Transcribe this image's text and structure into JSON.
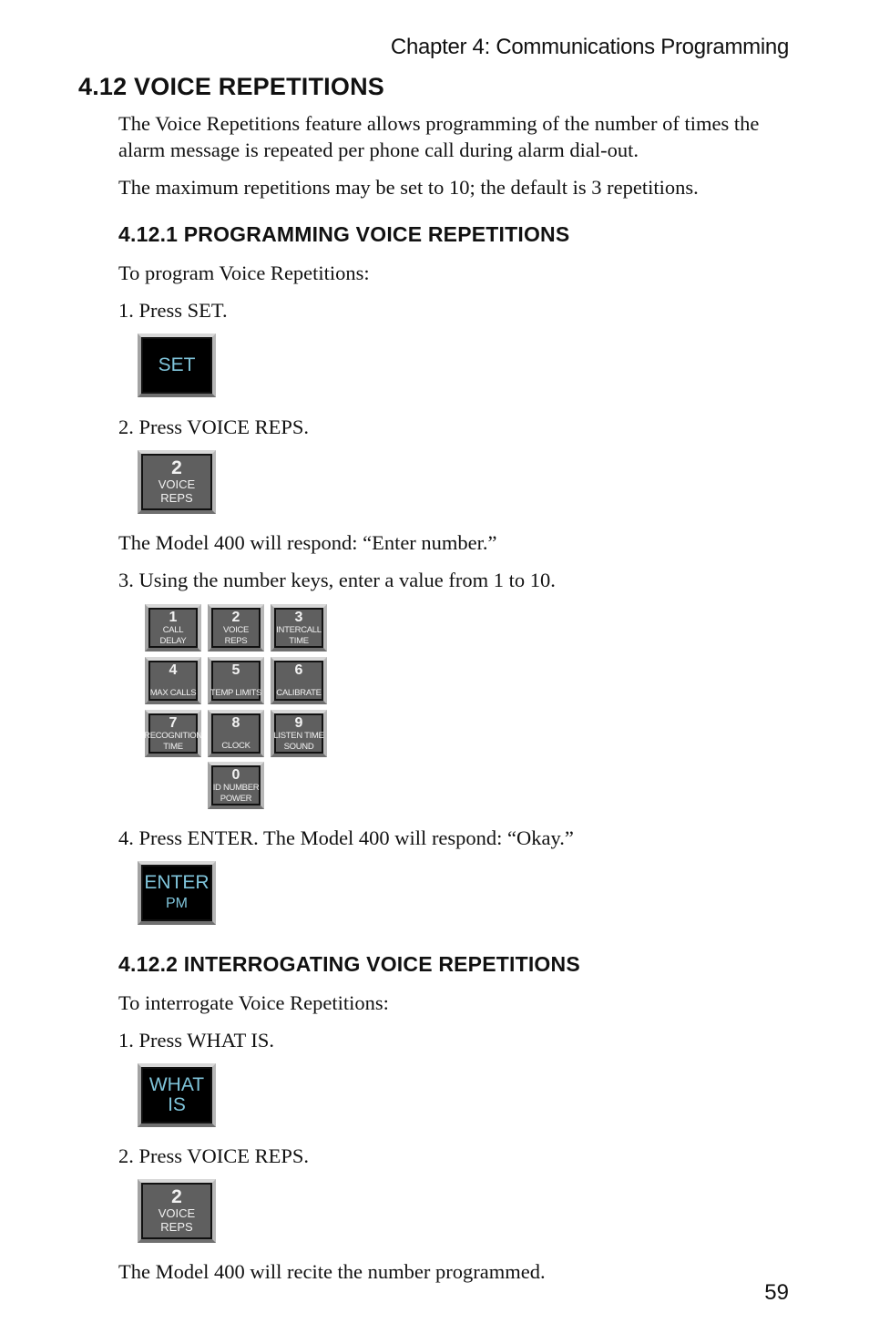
{
  "header": {
    "chapter": "Chapter 4: Communications Programming"
  },
  "section": {
    "title": "4.12 VOICE REPETITIONS",
    "paragraphs": [
      "The Voice Repetitions feature allows programming of the number of times the alarm message is repeated per phone call during alarm dial-out.",
      "The maximum repetitions may be set to 10; the default is 3 repetitions."
    ]
  },
  "programming": {
    "title": "4.12.1 PROGRAMMING VOICE REPETITIONS",
    "intro": "To program Voice Repetitions:",
    "step1": "1. Press SET.",
    "step2": "2. Press VOICE REPS.",
    "response1": "The Model 400 will respond: “Enter number.”",
    "step3": "3. Using the number keys, enter a value from 1 to 10.",
    "step4": "4. Press ENTER. The Model 400 will respond: “Okay.”"
  },
  "interrogating": {
    "title": "4.12.2 INTERROGATING VOICE REPETITIONS",
    "intro": "To interrogate Voice Repetitions:",
    "step1": "1. Press WHAT IS.",
    "step2": "2. Press VOICE REPS.",
    "result": "The Model 400 will recite the number programmed."
  },
  "keys": {
    "set": {
      "label": "SET"
    },
    "voice_reps": {
      "number": "2",
      "line1": "VOICE",
      "line2": "REPS"
    },
    "enter": {
      "line1": "ENTER",
      "line2": "PM"
    },
    "what_is": {
      "line1": "WHAT",
      "line2": "IS"
    }
  },
  "keypad": [
    {
      "number": "1",
      "line1": "CALL",
      "line2": "DELAY"
    },
    {
      "number": "2",
      "line1": "VOICE",
      "line2": "REPS"
    },
    {
      "number": "3",
      "line1": "INTERCALL",
      "line2": "TIME"
    },
    {
      "number": "4",
      "line1": "MAX CALLS",
      "line2": ""
    },
    {
      "number": "5",
      "line1": "TEMP LIMITS",
      "line2": ""
    },
    {
      "number": "6",
      "line1": "CALIBRATE",
      "line2": ""
    },
    {
      "number": "7",
      "line1": "RECOGNITION",
      "line2": "TIME"
    },
    {
      "number": "8",
      "line1": "",
      "line2": "CLOCK"
    },
    {
      "number": "9",
      "line1": "LISTEN TIME",
      "line2": "SOUND"
    },
    {
      "number": "0",
      "line1": "ID NUMBER",
      "line2": "POWER"
    }
  ],
  "colors": {
    "key_text_black": "#7fc4da",
    "key_face_gray": "#5f5f5f"
  },
  "page_number": "59"
}
